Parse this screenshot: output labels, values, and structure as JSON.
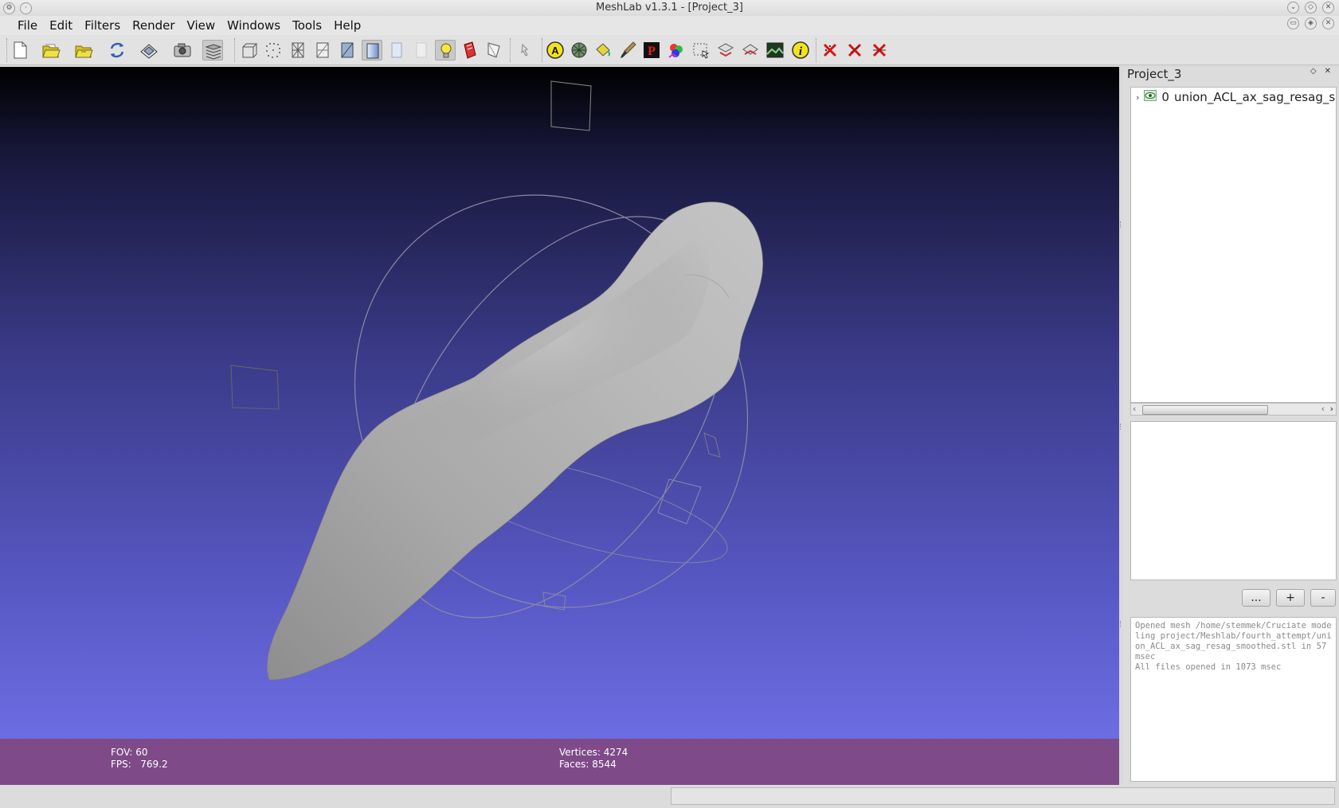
{
  "window": {
    "title": "MeshLab v1.3.1 - [Project_3]"
  },
  "menu": [
    "File",
    "Edit",
    "Filters",
    "Render",
    "View",
    "Windows",
    "Tools",
    "Help"
  ],
  "toolbar": {
    "tools": [
      "new-document-icon",
      "open-folder-icon",
      "open-project-icon",
      "reload-icon",
      "save-icon",
      "snapshot-camera-icon",
      "layers-icon",
      "bounding-box-icon",
      "points-icon",
      "wireframe-icon",
      "hidden-lines-icon",
      "flat-shading-icon",
      "smooth-shading-icon",
      "texture-icon",
      "lighting-bulb-icon",
      "backface-icon",
      "selection-icon",
      "pointer-icon",
      "annotation-a-icon",
      "texture-sphere-icon",
      "paint-bucket-icon",
      "brush-icon",
      "pick-points-icon",
      "color-palette-icon",
      "select-region-icon",
      "manipulate-icon",
      "align-icon",
      "raster-icon",
      "info-icon",
      "delete-icon",
      "delete-vertices-icon",
      "delete-faces-icon"
    ]
  },
  "viewport": {
    "info": {
      "fov_label": "FOV:",
      "fov_value": "60",
      "fps_label": "FPS:",
      "fps_value": "769.2",
      "vertices_label": "Vertices:",
      "vertices_value": "4274",
      "faces_label": "Faces:",
      "faces_value": "8544"
    }
  },
  "sidepanel": {
    "title": "Project_3",
    "layers": [
      {
        "index": "0",
        "name": "union_ACL_ax_sag_resag_smoothed"
      }
    ],
    "buttons": {
      "more": "...",
      "add": "+",
      "remove": "-"
    },
    "log": "Opened mesh /home/stemmek/Cruciate modeling project/Meshlab/fourth_attempt/union_ACL_ax_sag_resag_smoothed.stl in 57 msec\nAll files opened in 1073 msec"
  },
  "colors": {
    "infobar": "#7e4a88",
    "viewport_bottom": "#7474ec",
    "mesh": "#b4b4b4"
  }
}
